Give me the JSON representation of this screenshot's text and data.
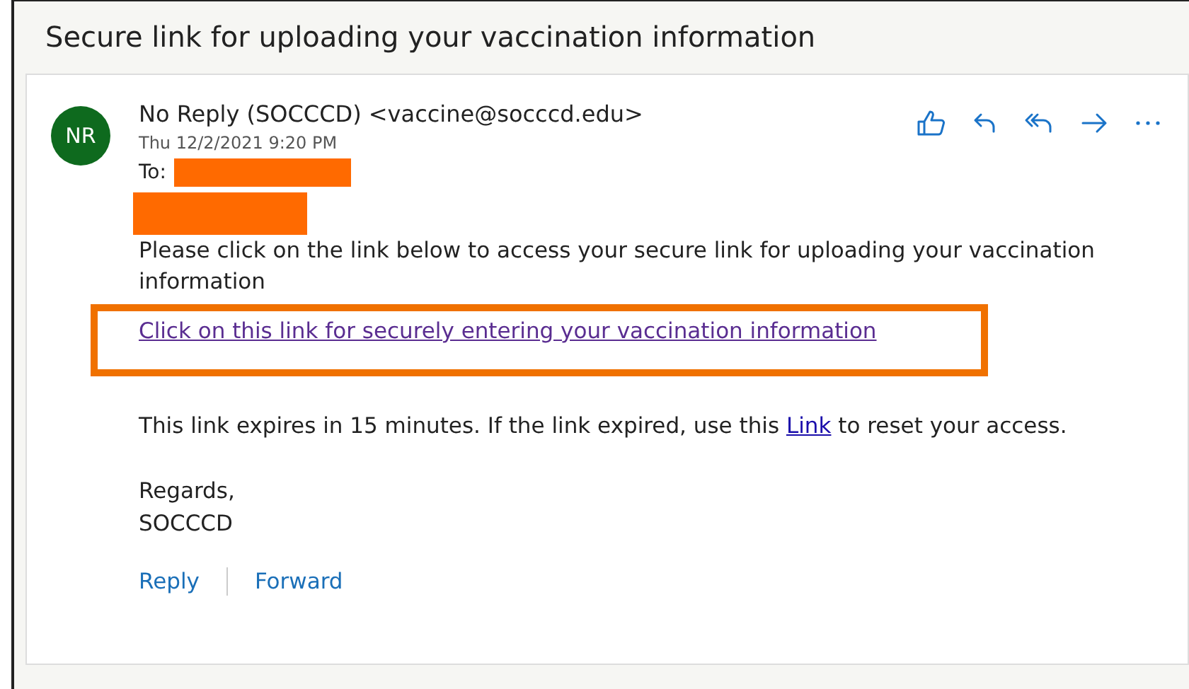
{
  "subject": "Secure link for uploading your vaccination information",
  "message": {
    "avatar": "NR",
    "sender": "No Reply (SOCCCD) <vaccine@socccd.edu>",
    "date": "Thu 12/2/2021 9:20 PM",
    "to_label": "To:",
    "body": "Please click on the link below to access your secure link for uploading your vaccination information",
    "highlighted_link": "Click on this link for securely entering your vaccination information",
    "expiry_before": "This link expires in 15 minutes. If the link expired, use this",
    "expiry_link": "Link",
    "expiry_after": "to reset your access.",
    "closing": "Regards,",
    "signature": "SOCCCD"
  },
  "actions": [
    "Reply",
    "Forward"
  ]
}
